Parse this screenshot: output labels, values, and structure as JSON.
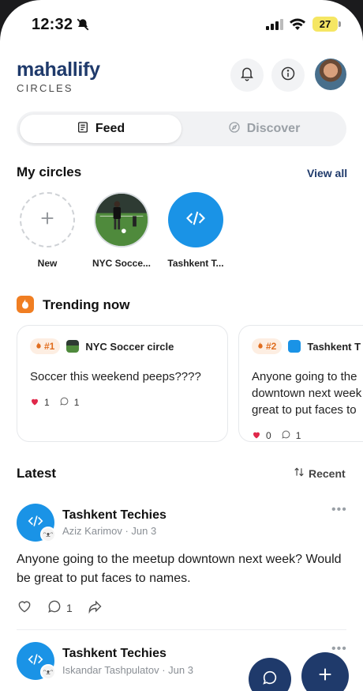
{
  "status_bar": {
    "time": "12:32",
    "battery": "27"
  },
  "header": {
    "brand": "mahallify",
    "subtitle": "CIRCLES"
  },
  "tabs": {
    "feed": "Feed",
    "discover": "Discover"
  },
  "my_circles": {
    "title": "My circles",
    "view_all": "View all",
    "items": [
      {
        "label": "New"
      },
      {
        "label": "NYC Socce..."
      },
      {
        "label": "Tashkent T..."
      }
    ]
  },
  "trending": {
    "title": "Trending now",
    "cards": [
      {
        "rank": "#1",
        "circle": "NYC Soccer circle",
        "text": "Soccer this weekend peeps????",
        "likes": "1",
        "comments": "1"
      },
      {
        "rank": "#2",
        "circle": "Tashkent T",
        "text": "Anyone going to the downtown next week great to put faces to",
        "likes": "0",
        "comments": "1"
      }
    ]
  },
  "latest": {
    "title": "Latest",
    "sort": "Recent",
    "posts": [
      {
        "circle": "Tashkent Techies",
        "meta": "Aziz Karimov · Jun 3",
        "body": "Anyone going to the meetup downtown next week? Would be great to put faces to names.",
        "comments": "1"
      },
      {
        "circle": "Tashkent Techies",
        "meta": "Iskandar Tashpulatov · Jun 3"
      }
    ]
  },
  "colors": {
    "brand": "#1f3a6b",
    "accent": "#1a93e6",
    "trending": "#f07e22",
    "like": "#e0284a"
  },
  "icons": [
    "bell-icon",
    "info-icon",
    "feed-icon",
    "compass-icon",
    "plus-icon",
    "code-icon",
    "flame-icon",
    "heart-icon",
    "comment-icon",
    "share-icon",
    "sort-icon",
    "more-icon",
    "chat-icon"
  ]
}
